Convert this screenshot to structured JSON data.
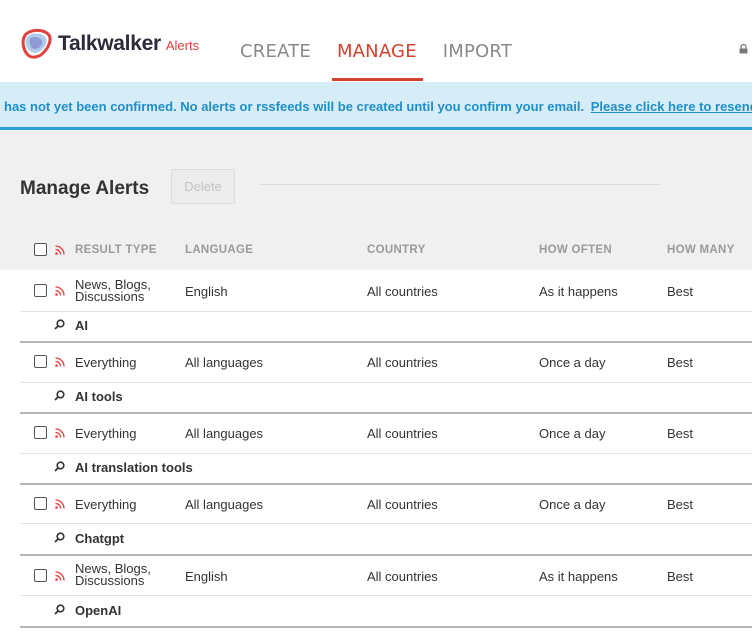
{
  "brand": {
    "name": "Talkwalker",
    "product": "Alerts"
  },
  "nav": {
    "create": "CREATE",
    "manage": "MANAGE",
    "import": "IMPORT"
  },
  "banner": {
    "message": "has not yet been confirmed. No alerts or rssfeeds will be created until you confirm your email.",
    "link": "Please click here to resend"
  },
  "page": {
    "title": "Manage Alerts",
    "delete_label": "Delete"
  },
  "table": {
    "headers": {
      "result_type": "RESULT TYPE",
      "language": "LANGUAGE",
      "country": "COUNTRY",
      "how_often": "HOW OFTEN",
      "how_many": "HOW MANY"
    },
    "rows": [
      {
        "result_type": "News, Blogs, Discussions",
        "language": "English",
        "country": "All countries",
        "how_often": "As it happens",
        "how_many": "Best",
        "name": "AI"
      },
      {
        "result_type": "Everything",
        "language": "All languages",
        "country": "All countries",
        "how_often": "Once a day",
        "how_many": "Best",
        "name": "AI tools"
      },
      {
        "result_type": "Everything",
        "language": "All languages",
        "country": "All countries",
        "how_often": "Once a day",
        "how_many": "Best",
        "name": "AI translation tools"
      },
      {
        "result_type": "Everything",
        "language": "All languages",
        "country": "All countries",
        "how_often": "Once a day",
        "how_many": "Best",
        "name": "Chatgpt"
      },
      {
        "result_type": "News, Blogs, Discussions",
        "language": "English",
        "country": "All countries",
        "how_often": "As it happens",
        "how_many": "Best",
        "name": "OpenAI"
      }
    ]
  },
  "colors": {
    "accent": "#d0442f",
    "banner_bg": "#d6ecf7",
    "banner_text": "#1f8fc9",
    "rss": "#e0413c"
  },
  "icons": {
    "logo": "talkwalker-logo-icon",
    "lock": "lock-icon",
    "rss": "rss-icon",
    "search": "search-icon"
  }
}
